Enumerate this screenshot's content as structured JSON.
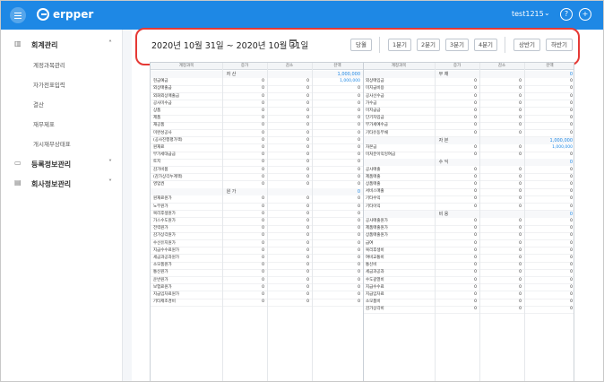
{
  "header": {
    "logo_text": "erpper",
    "user": "test1215",
    "help_icon": "help-icon",
    "plus_icon": "plus-icon"
  },
  "sidebar": {
    "sections": [
      {
        "label": "회계관리",
        "icon": "bar-chart-icon",
        "expanded": true,
        "sub": [
          "계정과목관리",
          "자가전표입력",
          "결산",
          "재무제표",
          "개시재무상태표"
        ]
      },
      {
        "label": "등록정보관리",
        "icon": "monitor-icon",
        "expanded": false
      },
      {
        "label": "회사정보관리",
        "icon": "document-icon",
        "expanded": false
      }
    ]
  },
  "date": {
    "range": "2020년 10월 31일  ~ 2020년 10월 31일"
  },
  "period_buttons": {
    "today": "당월",
    "q1": "1분기",
    "q2": "2분기",
    "q3": "3분기",
    "q4": "4분기",
    "h1": "상반기",
    "h2": "하반기"
  },
  "table": {
    "headers": [
      "계정과목",
      "증가",
      "감소",
      "잔액",
      "계정과목",
      "증가",
      "감소",
      "잔액"
    ],
    "left": {
      "section_asset": "자 산",
      "asset_total": "1,000,000",
      "assets": [
        {
          "name": "현금예금",
          "inc": "0",
          "dec": "0",
          "bal": "1,000,000"
        },
        {
          "name": "외상매출금",
          "inc": "0",
          "dec": "0",
          "bal": "0"
        },
        {
          "name": "외화외상매출금",
          "inc": "0",
          "dec": "0",
          "bal": "0"
        },
        {
          "name": "공사미수금",
          "inc": "0",
          "dec": "0",
          "bal": "0"
        },
        {
          "name": "상품",
          "inc": "0",
          "dec": "0",
          "bal": "0"
        },
        {
          "name": "제품",
          "inc": "0",
          "dec": "0",
          "bal": "0"
        },
        {
          "name": "재공품",
          "inc": "0",
          "dec": "0",
          "bal": "0"
        },
        {
          "name": "미완성공사",
          "inc": "0",
          "dec": "0",
          "bal": "0"
        },
        {
          "name": "(공사진행평가액)",
          "inc": "0",
          "dec": "0",
          "bal": "0"
        },
        {
          "name": "원재료",
          "inc": "0",
          "dec": "0",
          "bal": "0"
        },
        {
          "name": "부가세대급금",
          "inc": "0",
          "dec": "0",
          "bal": "0"
        },
        {
          "name": "토지",
          "inc": "0",
          "dec": "0",
          "bal": "0"
        },
        {
          "name": "감가비품",
          "inc": "0",
          "dec": "0",
          "bal": "0"
        },
        {
          "name": "(감가상각누계액)",
          "inc": "0",
          "dec": "0",
          "bal": "0"
        },
        {
          "name": "영업권",
          "inc": "0",
          "dec": "0",
          "bal": "0"
        }
      ],
      "section_cost": "원 가",
      "cost_total": "0",
      "costs": [
        {
          "name": "원재료원가",
          "inc": "0",
          "dec": "0",
          "bal": "0"
        },
        {
          "name": "노무원가",
          "inc": "0",
          "dec": "0",
          "bal": "0"
        },
        {
          "name": "복리후생원가",
          "inc": "0",
          "dec": "0",
          "bal": "0"
        },
        {
          "name": "가스수도원가",
          "inc": "0",
          "dec": "0",
          "bal": "0"
        },
        {
          "name": "전력원가",
          "inc": "0",
          "dec": "0",
          "bal": "0"
        },
        {
          "name": "감가상각원가",
          "inc": "0",
          "dec": "0",
          "bal": "0"
        },
        {
          "name": "수선유지원가",
          "inc": "0",
          "dec": "0",
          "bal": "0"
        },
        {
          "name": "지급수수료원가",
          "inc": "0",
          "dec": "0",
          "bal": "0"
        },
        {
          "name": "세금과공과원가",
          "inc": "0",
          "dec": "0",
          "bal": "0"
        },
        {
          "name": "소모품원가",
          "inc": "0",
          "dec": "0",
          "bal": "0"
        },
        {
          "name": "통신원가",
          "inc": "0",
          "dec": "0",
          "bal": "0"
        },
        {
          "name": "운반원가",
          "inc": "0",
          "dec": "0",
          "bal": "0"
        },
        {
          "name": "보험료원가",
          "inc": "0",
          "dec": "0",
          "bal": "0"
        },
        {
          "name": "지급임차료원가",
          "inc": "0",
          "dec": "0",
          "bal": "0"
        },
        {
          "name": "기타제조경비",
          "inc": "0",
          "dec": "0",
          "bal": "0"
        }
      ]
    },
    "right": {
      "section_liab": "부 채",
      "liab_total": "0",
      "liabs": [
        {
          "name": "외상매입금",
          "inc": "0",
          "dec": "0",
          "bal": "0"
        },
        {
          "name": "미지급비용",
          "inc": "0",
          "dec": "0",
          "bal": "0"
        },
        {
          "name": "공사선수금",
          "inc": "0",
          "dec": "0",
          "bal": "0"
        },
        {
          "name": "가수금",
          "inc": "0",
          "dec": "0",
          "bal": "0"
        },
        {
          "name": "미지급금",
          "inc": "0",
          "dec": "0",
          "bal": "0"
        },
        {
          "name": "단기차입금",
          "inc": "0",
          "dec": "0",
          "bal": "0"
        },
        {
          "name": "부가세예수금",
          "inc": "0",
          "dec": "0",
          "bal": "0"
        },
        {
          "name": "기타유동부채",
          "inc": "0",
          "dec": "0",
          "bal": "0"
        }
      ],
      "section_equity": "자 본",
      "equity_total": "1,000,000",
      "equities": [
        {
          "name": "자본금",
          "inc": "0",
          "dec": "0",
          "bal": "1,000,000"
        },
        {
          "name": "미처분이익잉여금",
          "inc": "0",
          "dec": "0",
          "bal": "0"
        }
      ],
      "section_income": "수 익",
      "income_total": "0",
      "incomes": [
        {
          "name": "공사매출",
          "inc": "0",
          "dec": "0",
          "bal": "0"
        },
        {
          "name": "제품매출",
          "inc": "0",
          "dec": "0",
          "bal": "0"
        },
        {
          "name": "상품매출",
          "inc": "0",
          "dec": "0",
          "bal": "0"
        },
        {
          "name": "서비스매출",
          "inc": "0",
          "dec": "0",
          "bal": "0"
        },
        {
          "name": "기타수익",
          "inc": "0",
          "dec": "0",
          "bal": "0"
        },
        {
          "name": "기타이익",
          "inc": "0",
          "dec": "0",
          "bal": "0"
        }
      ],
      "section_expense": "비 용",
      "expense_total": "0",
      "expenses": [
        {
          "name": "공사매출원가",
          "inc": "0",
          "dec": "0",
          "bal": "0"
        },
        {
          "name": "제품매출원가",
          "inc": "0",
          "dec": "0",
          "bal": "0"
        },
        {
          "name": "상품매출원가",
          "inc": "0",
          "dec": "0",
          "bal": "0"
        },
        {
          "name": "급여",
          "inc": "0",
          "dec": "0",
          "bal": "0"
        },
        {
          "name": "복리후생비",
          "inc": "0",
          "dec": "0",
          "bal": "0"
        },
        {
          "name": "여비교통비",
          "inc": "0",
          "dec": "0",
          "bal": "0"
        },
        {
          "name": "통신비",
          "inc": "0",
          "dec": "0",
          "bal": "0"
        },
        {
          "name": "세금과공과",
          "inc": "0",
          "dec": "0",
          "bal": "0"
        },
        {
          "name": "수도광열비",
          "inc": "0",
          "dec": "0",
          "bal": "0"
        },
        {
          "name": "지급수수료",
          "inc": "0",
          "dec": "0",
          "bal": "0"
        },
        {
          "name": "지급임차료",
          "inc": "0",
          "dec": "0",
          "bal": "0"
        },
        {
          "name": "소모품비",
          "inc": "0",
          "dec": "0",
          "bal": "0"
        },
        {
          "name": "감가상각비",
          "inc": "0",
          "dec": "0",
          "bal": "0"
        }
      ]
    }
  }
}
